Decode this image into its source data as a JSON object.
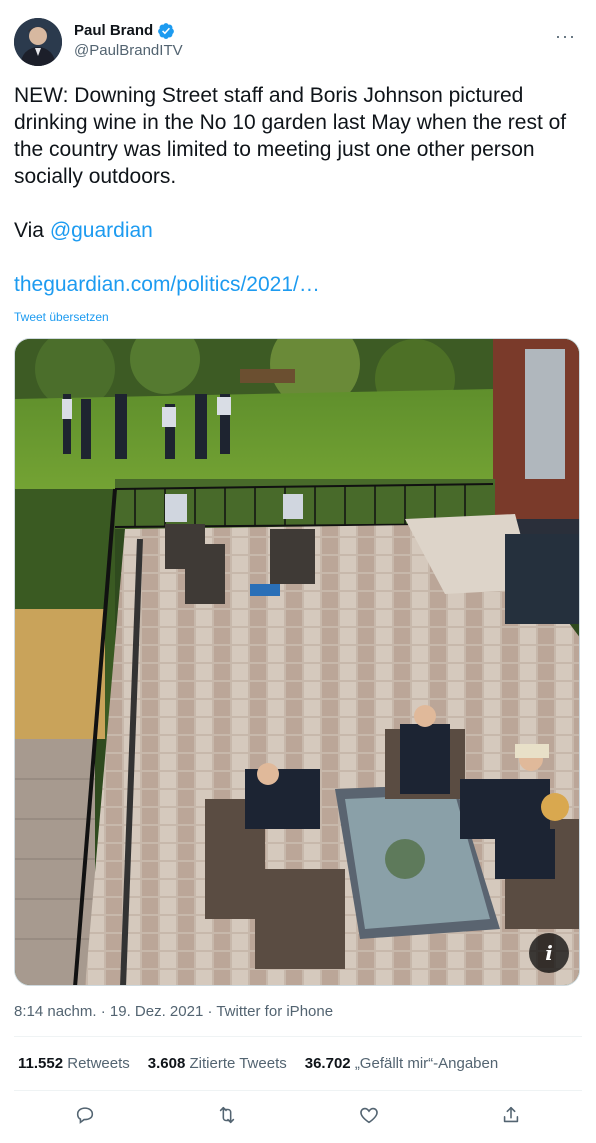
{
  "user": {
    "display_name": "Paul Brand",
    "handle": "@PaulBrandITV",
    "verified": true
  },
  "tweet": {
    "text_line_main": "NEW: Downing Street staff and Boris Johnson pictured drinking wine in the No 10 garden last May when the rest of the country was limited to meeting just one other person socially outdoors.",
    "via_label": "Via ",
    "via_mention": "@guardian",
    "link_text": "theguardian.com/politics/2021/…",
    "translate_label": "Tweet übersetzen",
    "timestamp": "8:14 nachm. · 19. Dez. 2021 · Twitter for iPhone"
  },
  "photo": {
    "alt_badge": "i"
  },
  "stats": [
    {
      "count": "11.552",
      "label": "Retweets"
    },
    {
      "count": "3.608",
      "label": "Zitierte Tweets"
    },
    {
      "count": "36.702",
      "label": "„Gefällt mir“-Angaben"
    }
  ],
  "actions": [
    "reply-icon",
    "retweet-icon",
    "like-icon",
    "share-icon"
  ],
  "colors": {
    "accent": "#1d9bf0",
    "secondary_text": "#536471"
  }
}
